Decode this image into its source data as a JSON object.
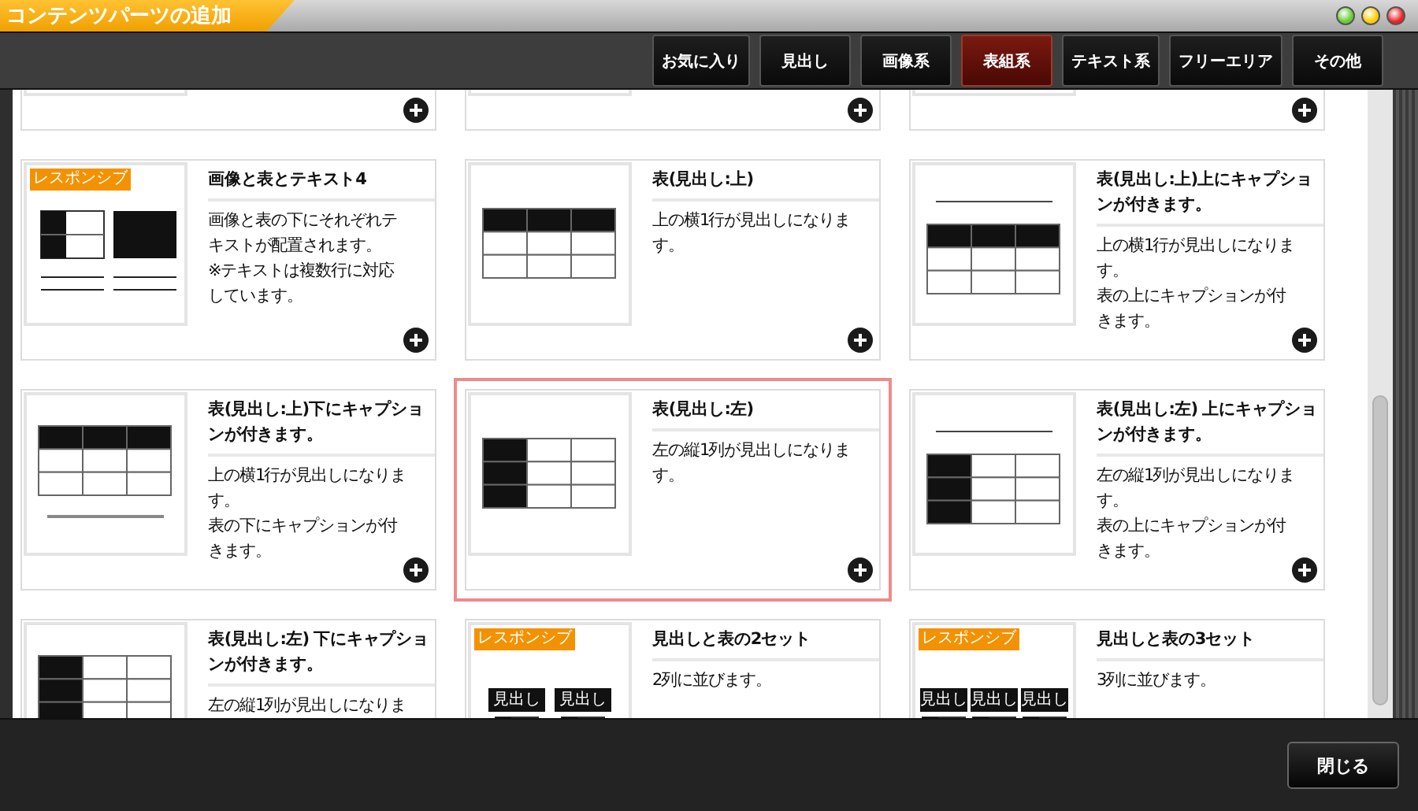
{
  "window": {
    "title": "コンテンツパーツの追加"
  },
  "tabs": [
    {
      "label": "お気に入り",
      "selected": false
    },
    {
      "label": "見出し",
      "selected": false
    },
    {
      "label": "画像系",
      "selected": false
    },
    {
      "label": "表組系",
      "selected": true
    },
    {
      "label": "テキスト系",
      "selected": false
    },
    {
      "label": "フリーエリア",
      "selected": false
    },
    {
      "label": "その他",
      "selected": false
    }
  ],
  "cards": [
    {
      "kind": "blank",
      "highlighted": false,
      "add_button": true
    },
    {
      "kind": "blank",
      "highlighted": false,
      "add_button": true
    },
    {
      "kind": "blank",
      "highlighted": false,
      "add_button": true
    },
    {
      "kind": "imagetable",
      "badge": "レスポンシブ",
      "title": "画像と表とテキスト4",
      "description": [
        "画像と表の下にそれぞれテキストが配置されます。",
        "※テキストは複数行に対応しています。"
      ],
      "highlighted": false,
      "add_button": true
    },
    {
      "kind": "tabletop",
      "title": "表(見出し:上)",
      "description": [
        "上の横1行が見出しになります。"
      ],
      "highlighted": false,
      "add_button": true
    },
    {
      "kind": "tabletopabove",
      "title": "表(見出し:上)上にキャプションが付きます。",
      "description": [
        "上の横1行が見出しになります。",
        "表の上にキャプションが付きます。"
      ],
      "highlighted": false,
      "add_button": true
    },
    {
      "kind": "tabletopbelow",
      "title": "表(見出し:上)下にキャプションが付きます。",
      "description": [
        "上の横1行が見出しになります。",
        "表の下にキャプションが付きます。"
      ],
      "highlighted": false,
      "add_button": true
    },
    {
      "kind": "tableleft",
      "title": "表(見出し:左)",
      "description": [
        "左の縦1列が見出しになります。"
      ],
      "highlighted": true,
      "add_button": true
    },
    {
      "kind": "tableleftabove",
      "title": "表(見出し:左) 上にキャプションが付きます。",
      "description": [
        "左の縦1列が見出しになります。",
        "表の上にキャプションが付きます。"
      ],
      "highlighted": false,
      "add_button": true
    },
    {
      "kind": "tableleftbelow",
      "title": "表(見出し:左) 下にキャプションが付きます。",
      "description": [
        "左の縦1列が見出しになりま"
      ],
      "highlighted": false
    },
    {
      "kind": "headingtables",
      "badge": "レスポンシブ",
      "thumb_labels": [
        "見出し",
        "見出し"
      ],
      "title": "見出しと表の2セット",
      "description": [
        "2列に並びます。"
      ],
      "highlighted": false
    },
    {
      "kind": "headingtables",
      "badge": "レスポンシブ",
      "thumb_labels": [
        "見出し",
        "見出し",
        "見出し"
      ],
      "title": "見出しと表の3セット",
      "description": [
        "3列に並びます。"
      ],
      "highlighted": false
    }
  ],
  "footer": {
    "close_button": "閉じる"
  }
}
